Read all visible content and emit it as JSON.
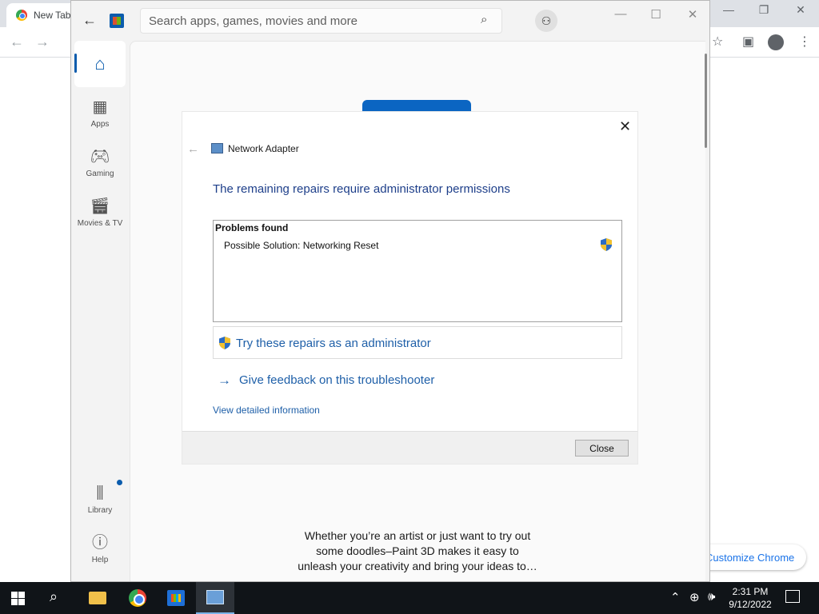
{
  "chrome": {
    "tab_title": "New Tab",
    "customize_label": "Customize Chrome",
    "minimize": "—",
    "restore": "❐",
    "close": "✕"
  },
  "store": {
    "search_placeholder": "Search apps, games, movies and more",
    "nav": [
      {
        "label": "Home",
        "icon": "home-icon"
      },
      {
        "label": "Apps",
        "icon": "apps-icon"
      },
      {
        "label": "Gaming",
        "icon": "gamepad-icon"
      },
      {
        "label": "Movies & TV",
        "icon": "clapperboard-icon"
      },
      {
        "label": "Library",
        "icon": "library-icon"
      },
      {
        "label": "Help",
        "icon": "help-icon"
      }
    ],
    "paint_description": "Whether you’re an artist or just want to try out some doodles–Paint 3D makes it easy to unleash your creativity and bring your ideas to…"
  },
  "dialog": {
    "app_name": "Network Adapter",
    "heading": "The remaining repairs require administrator permissions",
    "problems_title": "Problems found",
    "problem_item": "Possible Solution: Networking Reset",
    "admin_link": "Try these repairs as an administrator",
    "feedback_link": "Give feedback on this troubleshooter",
    "details_link": "View detailed information",
    "close_button": "Close"
  },
  "taskbar": {
    "time": "2:31 PM",
    "date": "9/12/2022"
  },
  "colors": {
    "accent": "#0b5cad",
    "link": "#1e5fa8",
    "heading": "#1e3f8a",
    "taskbar": "#101418"
  }
}
